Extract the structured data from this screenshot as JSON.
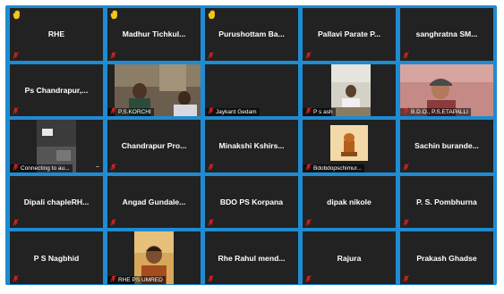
{
  "participants": [
    {
      "name": "RHE",
      "hand": true
    },
    {
      "name": "Madhur Tichkul...",
      "hand": true
    },
    {
      "name": "Purushottam Ba...",
      "hand": true
    },
    {
      "name": "Pallavi Parate P..."
    },
    {
      "name": "sanghratna SM..."
    },
    {
      "name": "Ps Chandrapur,..."
    },
    {
      "label": "P.S.KORCHI",
      "video": "two-men"
    },
    {
      "label": "Jaykant Gedam"
    },
    {
      "label": "P s ash",
      "video": "man-sitting"
    },
    {
      "label": "B.D.O., P.S.ETAPALLI",
      "video": "woman-cap"
    },
    {
      "label": "Connecting to au...",
      "video": "room",
      "status": "connecting"
    },
    {
      "name": "Chandrapur Pro..."
    },
    {
      "name": "Minakshi Kshirs..."
    },
    {
      "label": "Bdobdopschimur...",
      "video": "emblem"
    },
    {
      "name": "Sachin burande..."
    },
    {
      "name": "Dipali chapleRH..."
    },
    {
      "name": "Angad Gundale..."
    },
    {
      "name": "BDO PS Korpana"
    },
    {
      "name": "dipak nikole"
    },
    {
      "name": "P. S. Pombhurna"
    },
    {
      "name": "P S Nagbhid"
    },
    {
      "label": "RHE PS UMRED",
      "video": "man-close"
    },
    {
      "name": "Rhe Rahul mend..."
    },
    {
      "name": "Rajura"
    },
    {
      "name": "Prakash Ghadse"
    }
  ],
  "colors": {
    "border": "#1f8bd2",
    "tile": "#222222",
    "muted": "#e0201e",
    "hand": "#f5c518"
  }
}
